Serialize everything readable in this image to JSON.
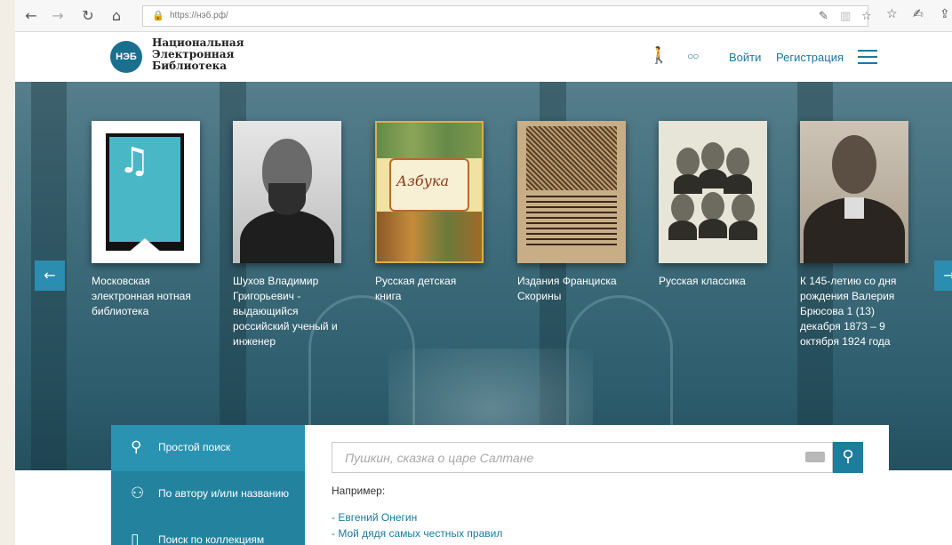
{
  "browser": {
    "url": "https://нэб.рф/",
    "back_icon": "←",
    "forward_icon": "→",
    "refresh_icon": "↻",
    "home_icon": "⌂"
  },
  "header": {
    "logo_abbr": "НЭБ",
    "logo_line1": "Национальная",
    "logo_line2": "Электронная",
    "logo_line3": "Библиотека",
    "login_label": "Войти",
    "register_label": "Регистрация"
  },
  "carousel": {
    "items": [
      {
        "label": "Московская электронная нотная библиотека"
      },
      {
        "label": "Шухов Владимир Григорьевич - выдающийся российский ученый и инженер"
      },
      {
        "label": "Русская детская книга"
      },
      {
        "label": "Издания Франциска Скорины"
      },
      {
        "label": "Русская классика"
      },
      {
        "label": "К 145-летию со дня рождения Валерия Брюсова 1 (13) декабря 1873 – 9 октября 1924 года"
      }
    ],
    "azbuka_title": "Азбука"
  },
  "search": {
    "tabs": [
      {
        "label": "Простой поиск",
        "icon": "search-icon"
      },
      {
        "label": "По автору и/или названию",
        "icon": "author-search-icon"
      },
      {
        "label": "Поиск по коллекциям",
        "icon": "collection-icon"
      }
    ],
    "placeholder": "Пушкин, сказка о царе Салтане",
    "example_label": "Например:",
    "examples": [
      "- Евгений Онегин",
      "- Мой дядя самых честных правил"
    ]
  },
  "colors": {
    "accent": "#1a7aa0",
    "hero": "#3f6c7b",
    "tab_bg": "#23839f"
  }
}
